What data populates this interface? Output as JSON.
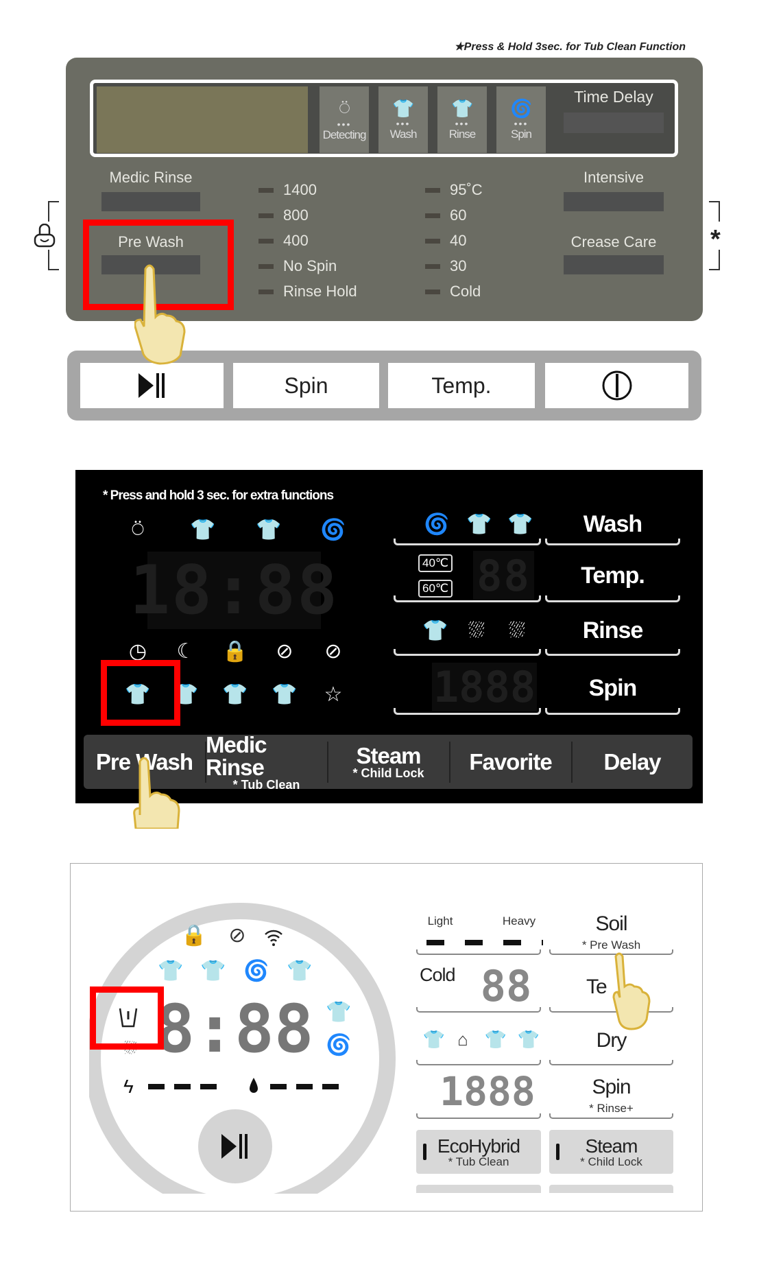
{
  "panel1": {
    "note": "★Press & Hold 3sec. for Tub Clean Function",
    "stages": [
      {
        "icon": "detecting-icon",
        "label": "Detecting"
      },
      {
        "icon": "wash-icon",
        "label": "Wash"
      },
      {
        "icon": "rinse-icon",
        "label": "Rinse"
      },
      {
        "icon": "spin-icon",
        "label": "Spin"
      }
    ],
    "time_delay": "Time Delay",
    "medic_rinse": "Medic Rinse",
    "pre_wash": "Pre Wash",
    "intensive": "Intensive",
    "crease_care": "Crease Care",
    "spin_options": [
      "1400",
      "800",
      "400",
      "No Spin",
      "Rinse Hold"
    ],
    "temp_options": [
      "95˚C",
      "60",
      "40",
      "30",
      "Cold"
    ],
    "star": "*",
    "buttons": {
      "start_pause": "▶||",
      "spin": "Spin",
      "temp": "Temp.",
      "power": "power-icon"
    }
  },
  "panel2": {
    "note": "* Press and hold 3 sec. for extra functions",
    "clock": "18:88",
    "wash": "Wash",
    "temp": "Temp.",
    "rinse": "Rinse",
    "spin": "Spin",
    "temp_tags": [
      "40℃",
      "60℃"
    ],
    "temp_digits": "88",
    "spin_digits": "1888",
    "buttons": [
      {
        "main": "Pre Wash",
        "sub": ""
      },
      {
        "main": "Medic Rinse",
        "sub": "* Tub Clean"
      },
      {
        "main": "Steam",
        "sub": "* Child Lock"
      },
      {
        "main": "Favorite",
        "sub": ""
      },
      {
        "main": "Delay",
        "sub": ""
      }
    ]
  },
  "panel3": {
    "clock": "8:88",
    "light": "Light",
    "heavy": "Heavy",
    "soil": "Soil",
    "soil_sub": "* Pre Wash",
    "cold": "Cold",
    "temp_digits": "88",
    "temp_partial": "Te",
    "dry": "Dry",
    "spin_digits": "1888",
    "spin": "Spin",
    "spin_sub": "* Rinse+",
    "eco": "EcoHybrid",
    "eco_sub": "* Tub Clean",
    "steam": "Steam",
    "steam_sub": "* Child Lock"
  },
  "colors": {
    "highlight": "#ff0000",
    "hand": "#f3e6b0",
    "hand_outline": "#d9b23a"
  }
}
